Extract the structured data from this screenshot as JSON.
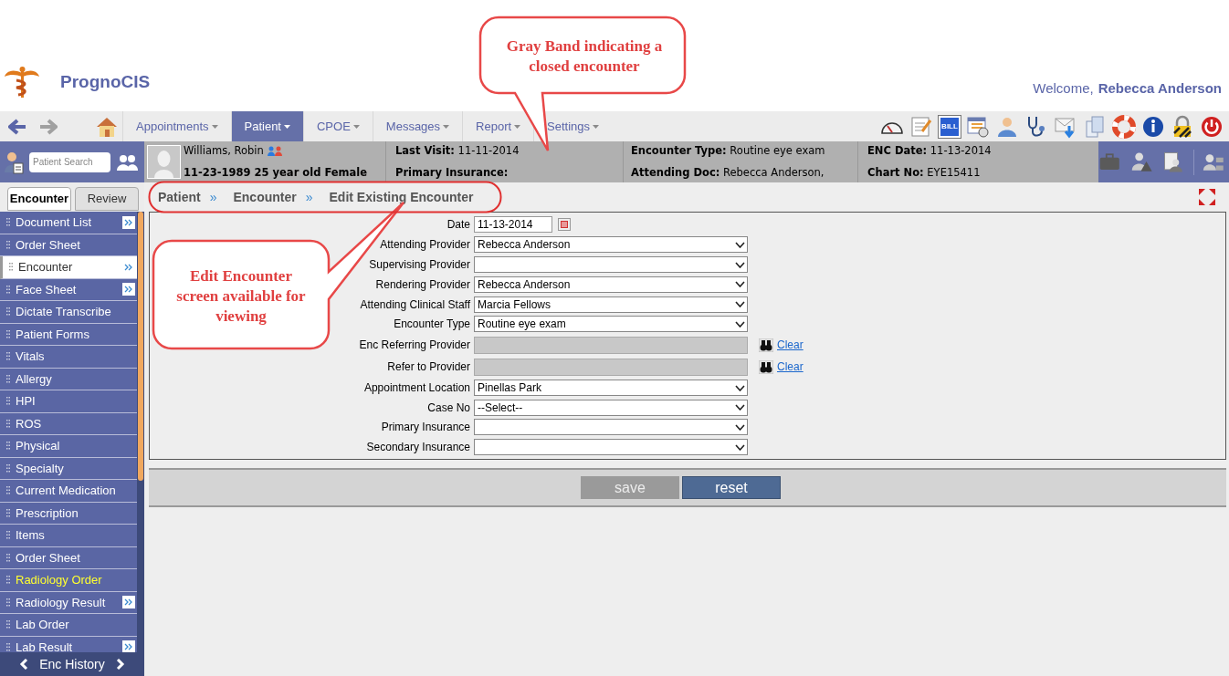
{
  "app": {
    "name": "PrognoCIS",
    "welcome": "Welcome,",
    "user": "Rebecca Anderson"
  },
  "nav": {
    "tabs": [
      {
        "label": "Appointments",
        "selected": false
      },
      {
        "label": "Patient",
        "selected": true
      },
      {
        "label": "CPOE",
        "selected": false
      },
      {
        "label": "Messages",
        "selected": false
      },
      {
        "label": "Report",
        "selected": false
      },
      {
        "label": "Settings",
        "selected": false
      }
    ],
    "toolbar": [
      {
        "kind": "gauge"
      },
      {
        "kind": "note"
      },
      {
        "kind": "bill",
        "label": "BILL"
      },
      {
        "kind": "calendar"
      },
      {
        "kind": "user"
      },
      {
        "kind": "stethoscope"
      },
      {
        "kind": "mail"
      },
      {
        "kind": "documents"
      },
      {
        "kind": "lifebuoy"
      },
      {
        "kind": "info"
      },
      {
        "kind": "lock"
      },
      {
        "kind": "power"
      }
    ]
  },
  "patient_search": {
    "placeholder": "Patient Search"
  },
  "patient_band": {
    "name": "Williams, Robin",
    "details": "11-23-1989 25 year old Female",
    "closed": true,
    "columns": [
      [
        "**Last Visit:** 11-11-2014",
        "**Primary Insurance:**"
      ],
      [
        "**Encounter Type:** Routine eye exam",
        "**Attending Doc:** Rebecca Anderson,"
      ],
      [
        "**ENC Date:** 11-13-2014",
        "**Chart No:** EYE15411"
      ]
    ],
    "actions": [
      {
        "kind": "briefcase"
      },
      {
        "kind": "user-warning"
      },
      {
        "kind": "user-document"
      },
      {
        "kind": "user-network"
      }
    ]
  },
  "sidebar": {
    "tabs": [
      {
        "label": "Encounter",
        "selected": true
      },
      {
        "label": "Review",
        "selected": false
      }
    ],
    "items": [
      {
        "label": "Document List",
        "selected": false,
        "expand": true,
        "highlighted": false
      },
      {
        "label": "Order Sheet",
        "selected": false,
        "expand": false,
        "highlighted": false
      },
      {
        "label": "Encounter",
        "selected": true,
        "expand": true,
        "highlighted": false
      },
      {
        "label": "Face Sheet",
        "selected": false,
        "expand": true,
        "highlighted": false
      },
      {
        "label": "Dictate Transcribe",
        "selected": false,
        "expand": false,
        "highlighted": false
      },
      {
        "label": "Patient Forms",
        "selected": false,
        "expand": false,
        "highlighted": false
      },
      {
        "label": "Vitals",
        "selected": false,
        "expand": false,
        "highlighted": false
      },
      {
        "label": "Allergy",
        "selected": false,
        "expand": false,
        "highlighted": false
      },
      {
        "label": "HPI",
        "selected": false,
        "expand": false,
        "highlighted": false
      },
      {
        "label": "ROS",
        "selected": false,
        "expand": false,
        "highlighted": false
      },
      {
        "label": "Physical",
        "selected": false,
        "expand": false,
        "highlighted": false
      },
      {
        "label": "Specialty",
        "selected": false,
        "expand": false,
        "highlighted": false
      },
      {
        "label": "Current Medication",
        "selected": false,
        "expand": false,
        "highlighted": false
      },
      {
        "label": "Prescription",
        "selected": false,
        "expand": false,
        "highlighted": false
      },
      {
        "label": "Items",
        "selected": false,
        "expand": false,
        "highlighted": false
      },
      {
        "label": "Order Sheet",
        "selected": false,
        "expand": false,
        "highlighted": false
      },
      {
        "label": "Radiology Order",
        "selected": false,
        "expand": false,
        "highlighted": true
      },
      {
        "label": "Radiology Result",
        "selected": false,
        "expand": true,
        "highlighted": false
      },
      {
        "label": "Lab Order",
        "selected": false,
        "expand": false,
        "highlighted": false
      },
      {
        "label": "Lab Result",
        "selected": false,
        "expand": true,
        "highlighted": false
      }
    ],
    "footer": "Enc History"
  },
  "breadcrumb": [
    {
      "label": "Patient",
      "separator": "»"
    },
    {
      "label": "Encounter",
      "separator": "»"
    },
    {
      "label": "Edit Existing Encounter"
    }
  ],
  "form": {
    "fields": [
      {
        "label": "Date",
        "kind": "date",
        "value": "11-13-2014"
      },
      {
        "label": "Attending Provider",
        "kind": "select",
        "value": "Rebecca Anderson"
      },
      {
        "label": "Supervising Provider",
        "kind": "select"
      },
      {
        "label": "Rendering Provider",
        "kind": "select",
        "value": "Rebecca Anderson"
      },
      {
        "label": "Attending Clinical Staff",
        "kind": "select",
        "value": "Marcia Fellows"
      },
      {
        "label": "Encounter Type",
        "kind": "select",
        "value": "Routine eye exam"
      },
      {
        "label": "Enc Referring Provider",
        "kind": "lookup",
        "action": "Clear"
      },
      {
        "label": "Refer to Provider",
        "kind": "lookup",
        "action": "Clear"
      },
      {
        "label": "Appointment Location",
        "kind": "select",
        "value": "Pinellas Park"
      },
      {
        "label": "Case No",
        "kind": "select",
        "value": "--Select--"
      },
      {
        "label": "Primary Insurance",
        "kind": "select"
      },
      {
        "label": "Secondary Insurance",
        "kind": "select"
      }
    ],
    "buttons": [
      {
        "label": "save",
        "disabled": true
      },
      {
        "label": "reset",
        "disabled": false
      }
    ]
  },
  "annotations": [
    {
      "kind": "callout-top",
      "text": "Gray Band indicating a closed encounter"
    },
    {
      "kind": "callout-left",
      "text": "Edit Encounter screen available for viewing"
    },
    {
      "kind": "ellipse"
    }
  ]
}
